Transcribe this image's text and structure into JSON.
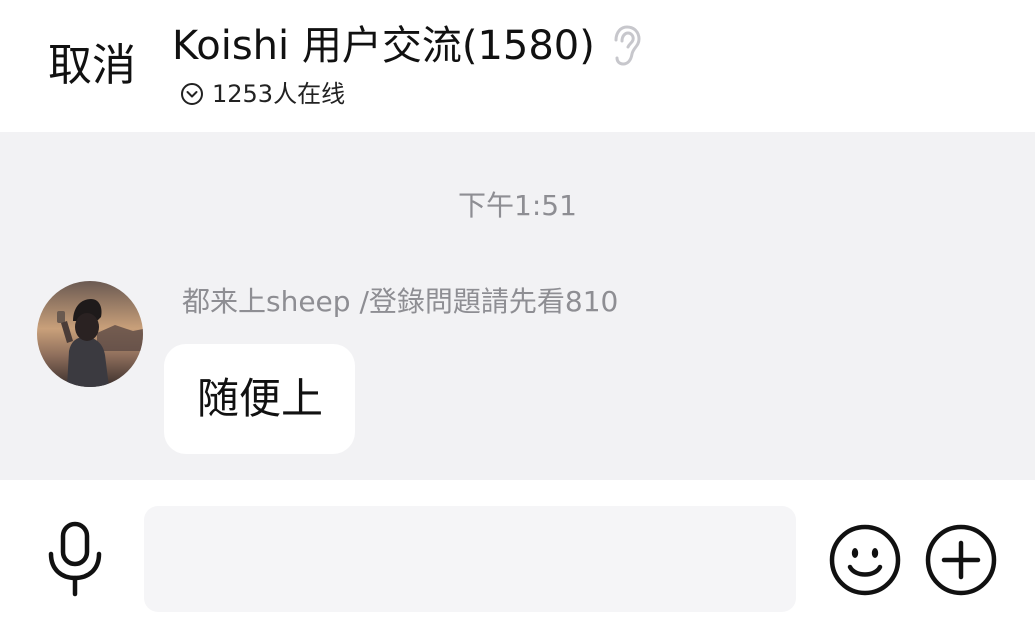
{
  "header": {
    "cancel_label": "取消",
    "group_title": "Koishi 用户交流(1580)",
    "online_text": "1253人在线",
    "ear_icon": "ear-icon",
    "online_icon": "chevron-down-circle-icon"
  },
  "chat": {
    "timestamp": "下午1:51",
    "messages": [
      {
        "sender": "都来上sheep /登錄問題請先看810",
        "text": "随便上",
        "avatar_icon": "avatar"
      }
    ]
  },
  "input_bar": {
    "mic_icon": "microphone-icon",
    "input_value": "",
    "input_placeholder": "",
    "emoji_icon": "smiley-icon",
    "plus_icon": "plus-circle-icon"
  },
  "colors": {
    "chat_background": "#f2f2f4",
    "bubble_background": "#ffffff",
    "muted_text": "#8e8e93",
    "input_background": "#f5f5f7"
  }
}
